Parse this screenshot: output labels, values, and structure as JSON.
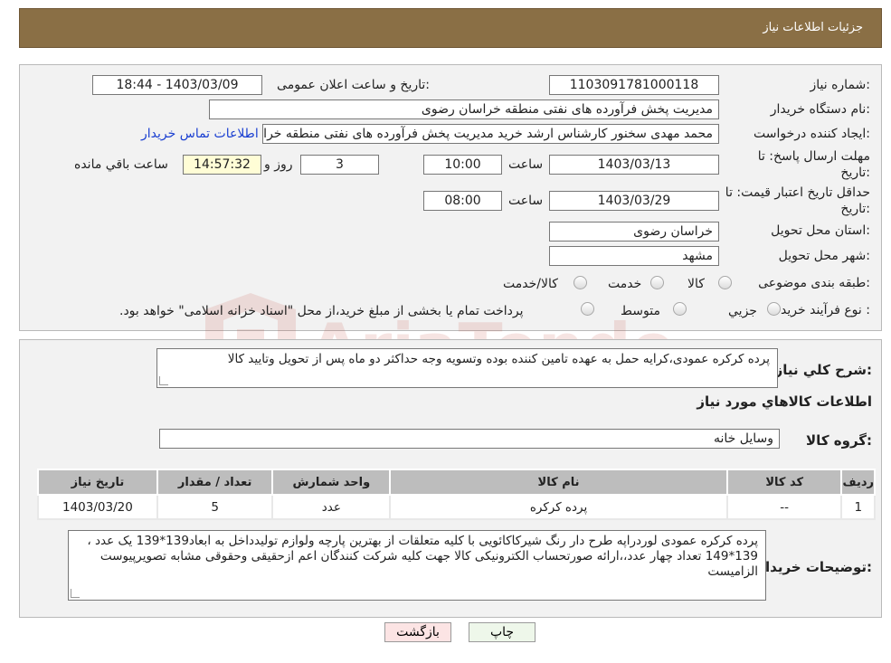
{
  "header": {
    "title": "جزئیات اطلاعات نیاز"
  },
  "fields": {
    "need_number_label": "شماره نیاز:",
    "need_number": "1103091781000118",
    "announce_label": "تاریخ و ساعت اعلان عمومی:",
    "announce_value": "1403/03/09 - 18:44",
    "buyer_org_label": "نام دستگاه خریدار:",
    "buyer_org": "مدیریت پخش فرآورده های نفتی منطقه خراسان رضوی",
    "creator_label": "ایجاد کننده درخواست:",
    "creator": "محمد مهدی سخنور کارشناس ارشد خرید مدیریت پخش فرآورده های نفتی منطقه خراسان رضوی",
    "contact_link": "اطلاعات تماس خریدار",
    "deadline_label": "مهلت ارسال پاسخ: تا",
    "deadline_label2": "تاریخ:",
    "deadline_date": "1403/03/13",
    "time_label": "ساعت",
    "deadline_time": "10:00",
    "days_value": "3",
    "days_label": "روز و",
    "remaining_time": "14:57:32",
    "remaining_label": "ساعت باقي مانده",
    "validity_label": "حداقل تاریخ اعتبار قیمت: تا",
    "validity_label2": "تاریخ:",
    "validity_date": "1403/03/29",
    "validity_time": "08:00",
    "province_label": "استان محل تحویل:",
    "province": "خراسان رضوی",
    "city_label": "شهر محل تحویل:",
    "city": "مشهد",
    "category_label": "طبقه بندی موضوعی:",
    "category_options": [
      "کالا",
      "خدمت",
      "کالا/خدمت"
    ],
    "purchase_type_label": "نوع فرآیند خرید :",
    "purchase_options": [
      "جزيي",
      "متوسط"
    ],
    "purchase_note": "پرداخت تمام یا بخشی از مبلغ خرید،از محل \"اسناد خزانه اسلامی\" خواهد بود."
  },
  "summary": {
    "label": "شرح كلي نياز:",
    "text": "پرده کرکره عمودی،کرایه حمل به عهده تامین کننده بوده وتسویه وجه حداکثر دو ماه پس از تحویل وتایید کالا"
  },
  "goods_info_title": "اطلاعات كالاهاي مورد نياز",
  "goods_group": {
    "label": "گروه كالا:",
    "value": "وسایل خانه"
  },
  "table": {
    "headers": [
      "رديف",
      "كد كالا",
      "نام كالا",
      "واحد شمارش",
      "تعداد / مقدار",
      "تاريخ نياز"
    ],
    "rows": [
      [
        "1",
        "--",
        "پرده کرکره",
        "عدد",
        "5",
        "1403/03/20"
      ]
    ]
  },
  "buyer_notes": {
    "label": "توضيحات خريدار:",
    "text": "پرده کرکره عمودی لوردراپه طرح دار رنگ شیرکاکائویی با کلیه متعلقات از بهترین پارچه ولوازم تولیدداخل به ابعاد139*139 یک عدد ، 139*149 تعداد چهار عدد،،ارائه صورتحساب الکترونیکی کالا جهت کلیه شرکت کنندگان اعم ازحقیقی وحقوقی مشابه تصویرپیوست الزامیست"
  },
  "buttons": {
    "print": "چاپ",
    "back": "بازگشت"
  },
  "watermark": {
    "brand_text": "AriaTender.neT"
  },
  "colors": {
    "header_bg": "#8a6f45",
    "panel_bg": "#f2f2f2",
    "link": "#1a3fd1",
    "highlight": "#fffdd6"
  }
}
